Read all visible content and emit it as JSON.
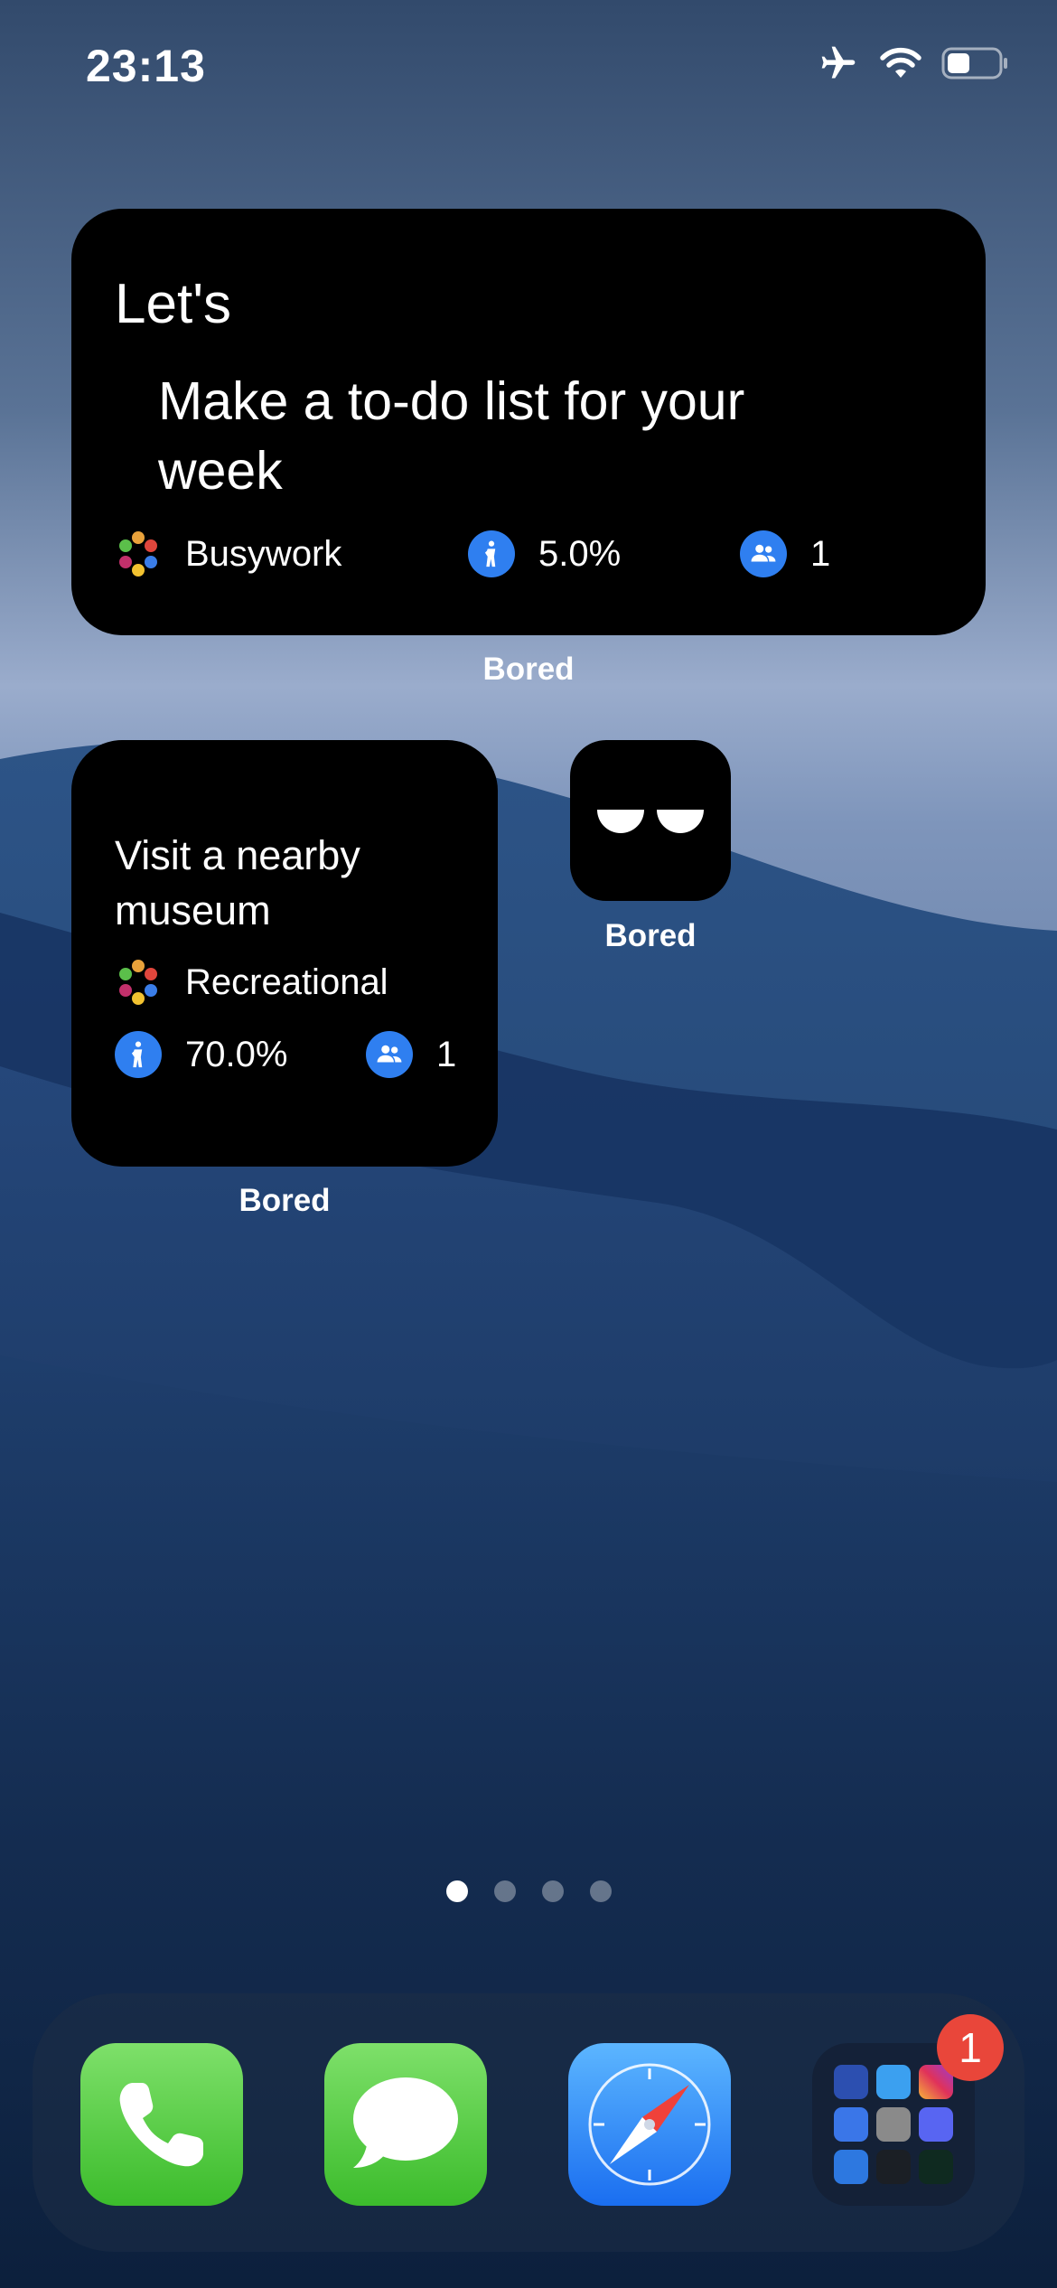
{
  "status_bar": {
    "time": "23:13",
    "battery_level": 0.45
  },
  "widgets": {
    "large": {
      "prefix": "Let's",
      "activity": "Make a to-do list for your week",
      "type": "Busywork",
      "accessibility": "5.0%",
      "participants": "1",
      "label": "Bored"
    },
    "small": {
      "activity": "Visit a nearby museum",
      "type": "Recreational",
      "accessibility": "70.0%",
      "participants": "1",
      "label": "Bored"
    },
    "app_icon": {
      "label": "Bored"
    }
  },
  "page_indicator": {
    "pages": 4,
    "current": 1
  },
  "dock": {
    "apps": [
      "phone-app",
      "messages-app",
      "safari-app",
      "app-folder"
    ],
    "folder_badge": "1"
  },
  "colors": {
    "accent_blue": "#2f7ff0",
    "badge_red": "#e9463a",
    "widget_bg": "#000000"
  }
}
